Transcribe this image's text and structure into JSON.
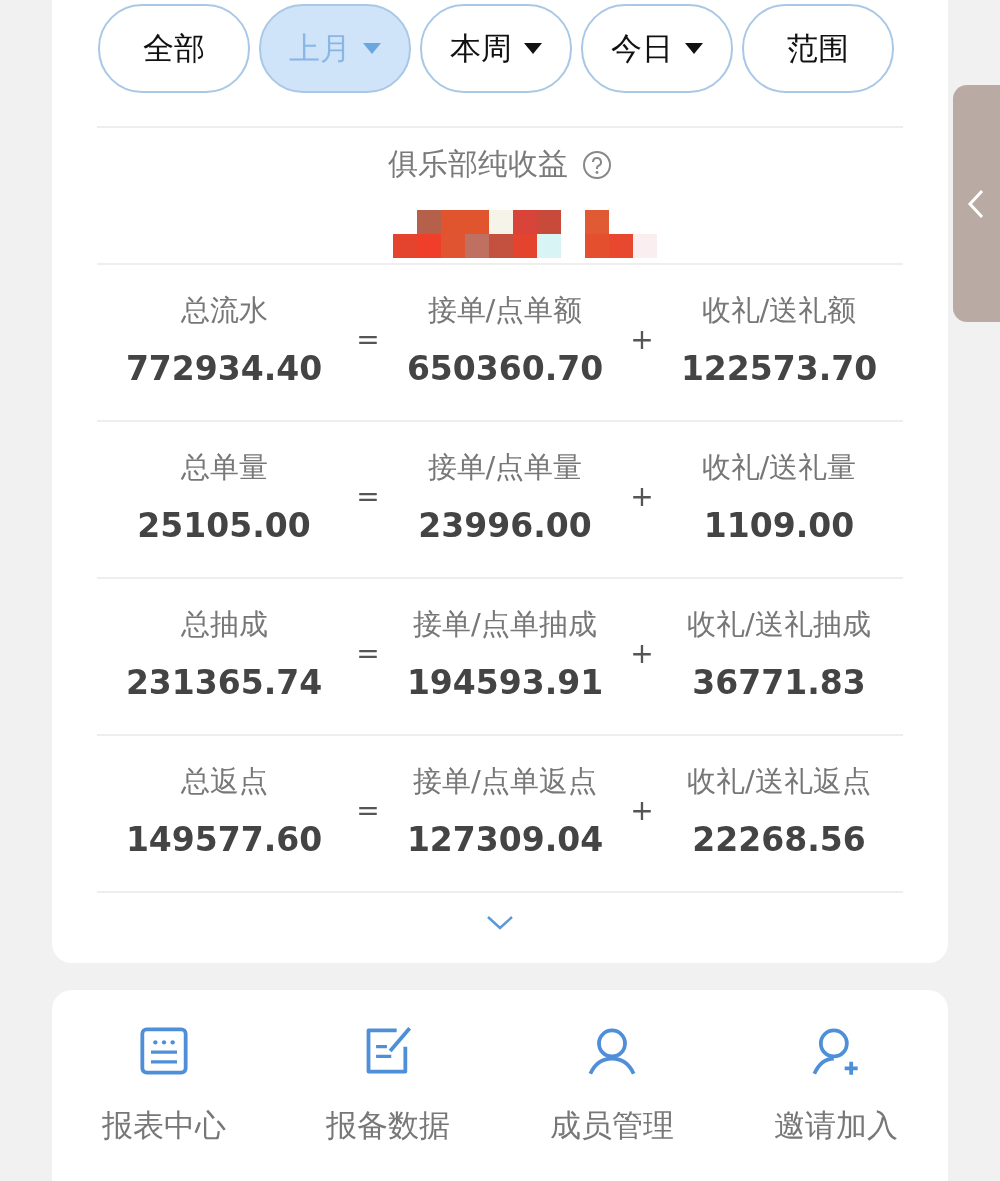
{
  "filters": [
    {
      "label": "全部",
      "selected": false,
      "dropdown": false
    },
    {
      "label": "上月",
      "selected": true,
      "dropdown": true
    },
    {
      "label": "本周",
      "selected": false,
      "dropdown": true
    },
    {
      "label": "今日",
      "selected": false,
      "dropdown": true
    },
    {
      "label": "范围",
      "selected": false,
      "dropdown": false
    }
  ],
  "summary": {
    "title": "俱乐部纯收益"
  },
  "rows": [
    {
      "items": [
        {
          "label": "总流水",
          "value": "772934.40"
        },
        {
          "label": "接单/点单额",
          "value": "650360.70"
        },
        {
          "label": "收礼/送礼额",
          "value": "122573.70"
        }
      ],
      "operators": [
        "=",
        "+"
      ]
    },
    {
      "items": [
        {
          "label": "总单量",
          "value": "25105.00"
        },
        {
          "label": "接单/点单量",
          "value": "23996.00"
        },
        {
          "label": "收礼/送礼量",
          "value": "1109.00"
        }
      ],
      "operators": [
        "=",
        "+"
      ]
    },
    {
      "items": [
        {
          "label": "总抽成",
          "value": "231365.74"
        },
        {
          "label": "接单/点单抽成",
          "value": "194593.91"
        },
        {
          "label": "收礼/送礼抽成",
          "value": "36771.83"
        }
      ],
      "operators": [
        "=",
        "+"
      ]
    },
    {
      "items": [
        {
          "label": "总返点",
          "value": "149577.60"
        },
        {
          "label": "接单/点单返点",
          "value": "127309.04"
        },
        {
          "label": "收礼/送礼返点",
          "value": "22268.56"
        }
      ],
      "operators": [
        "=",
        "+"
      ]
    }
  ],
  "actions": [
    {
      "label": "报表中心",
      "kind": "report"
    },
    {
      "label": "报备数据",
      "kind": "edit"
    },
    {
      "label": "成员管理",
      "kind": "user"
    },
    {
      "label": "邀请加入",
      "kind": "user-add"
    }
  ]
}
